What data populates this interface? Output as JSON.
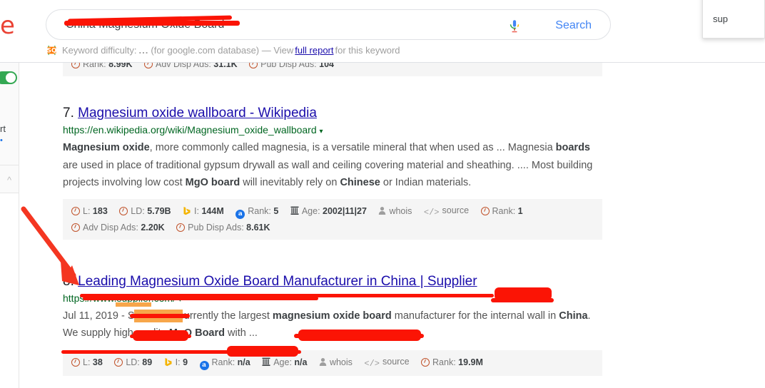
{
  "header": {
    "logo_text": "e",
    "search": {
      "value": "China Magnesium Oxide Board",
      "placeholder": "Search",
      "mic_icon": "microphone-icon",
      "button_label": "Search"
    },
    "keyword_difficulty": {
      "badge": "SQ",
      "label": "Keyword difficulty:",
      "value": "...",
      "database_note": "(for google.com database) — View",
      "link_label": "full report",
      "suffix": "for this keyword"
    }
  },
  "left_rail": {
    "toggle_state": "on",
    "toggle_color": "#34a853",
    "label_partial": "rt",
    "collapse_icon": "chevron-up-icon"
  },
  "right_popup": {
    "text": "sup"
  },
  "results": [
    {
      "id": "result-partial-top",
      "stats_rows": [
        [
          {
            "icon": "circle-icon",
            "label": "Rank:",
            "value": "8.99K"
          },
          {
            "icon": "circle-icon",
            "label": "Adv Disp Ads:",
            "value": "31.1K"
          },
          {
            "icon": "circle-icon",
            "label": "Pub Disp Ads:",
            "value": "104"
          }
        ]
      ]
    },
    {
      "id": "result-7",
      "number": "7.",
      "title": "Magnesium oxide wallboard - Wikipedia",
      "url": "https://en.wikipedia.org/wiki/Magnesium_oxide_wallboard",
      "url_caret": "▾",
      "snippet_parts": [
        {
          "t": "Magnesium oxide",
          "b": true
        },
        {
          "t": ", more commonly called magnesia, is a versatile mineral that when used as ... Magnesia ",
          "b": false
        },
        {
          "t": "boards",
          "b": true
        },
        {
          "t": " are used in place of traditional gypsum drywall as wall and ceiling covering material and sheathing. .... Most building projects involving low cost ",
          "b": false
        },
        {
          "t": "MgO board",
          "b": true
        },
        {
          "t": " will inevitably rely on ",
          "b": false
        },
        {
          "t": "Chinese",
          "b": true
        },
        {
          "t": " or Indian materials.",
          "b": false
        }
      ],
      "stats_rows": [
        [
          {
            "icon": "circle-icon",
            "label": "L:",
            "value": "183"
          },
          {
            "icon": "circle-icon",
            "label": "LD:",
            "value": "5.79B"
          },
          {
            "icon": "bing-icon",
            "label": "I:",
            "value": "144M"
          },
          {
            "icon": "alexa-icon",
            "label": "Rank:",
            "value": "5"
          },
          {
            "icon": "archive-icon",
            "label": "Age:",
            "value": "2002|11|27"
          },
          {
            "icon": "whois-icon",
            "label": "whois",
            "value": ""
          },
          {
            "icon": "source-icon",
            "label": "source",
            "value": ""
          },
          {
            "icon": "circle-icon",
            "label": "Rank:",
            "value": "1"
          }
        ],
        [
          {
            "icon": "circle-icon",
            "label": "Adv Disp Ads:",
            "value": "2.20K"
          },
          {
            "icon": "circle-icon",
            "label": "Pub Disp Ads:",
            "value": "8.61K"
          }
        ]
      ]
    },
    {
      "id": "result-8",
      "number": "8.",
      "title": "Leading Magnesium Oxide Board Manufacturer in China | Supplier",
      "url": "https://www.supplier.com/",
      "url_caret": "▾",
      "snippet_parts": [
        {
          "t": "Jul 11, 2019 - Supplier is currently the largest ",
          "b": false
        },
        {
          "t": "magnesium oxide board",
          "b": true
        },
        {
          "t": " manufacturer for the internal wall in ",
          "b": false
        },
        {
          "t": "China",
          "b": true
        },
        {
          "t": ". We supply high quality ",
          "b": false
        },
        {
          "t": "MgO Board",
          "b": true
        },
        {
          "t": " with ...",
          "b": false
        }
      ],
      "stats_rows": [
        [
          {
            "icon": "circle-icon",
            "label": "L:",
            "value": "38"
          },
          {
            "icon": "circle-icon",
            "label": "LD:",
            "value": "89"
          },
          {
            "icon": "bing-icon",
            "label": "I:",
            "value": "9"
          },
          {
            "icon": "alexa-icon",
            "label": "Rank:",
            "value": "n/a"
          },
          {
            "icon": "archive-icon",
            "label": "Age:",
            "value": "n/a"
          },
          {
            "icon": "whois-icon",
            "label": "whois",
            "value": ""
          },
          {
            "icon": "source-icon",
            "label": "source",
            "value": ""
          },
          {
            "icon": "circle-icon",
            "label": "Rank:",
            "value": "19.9M"
          }
        ]
      ]
    }
  ],
  "annotations": {
    "arrow_color": "#fb1405",
    "strikeout_color": "#fb1405",
    "highlight_color": "#f7a64a"
  }
}
